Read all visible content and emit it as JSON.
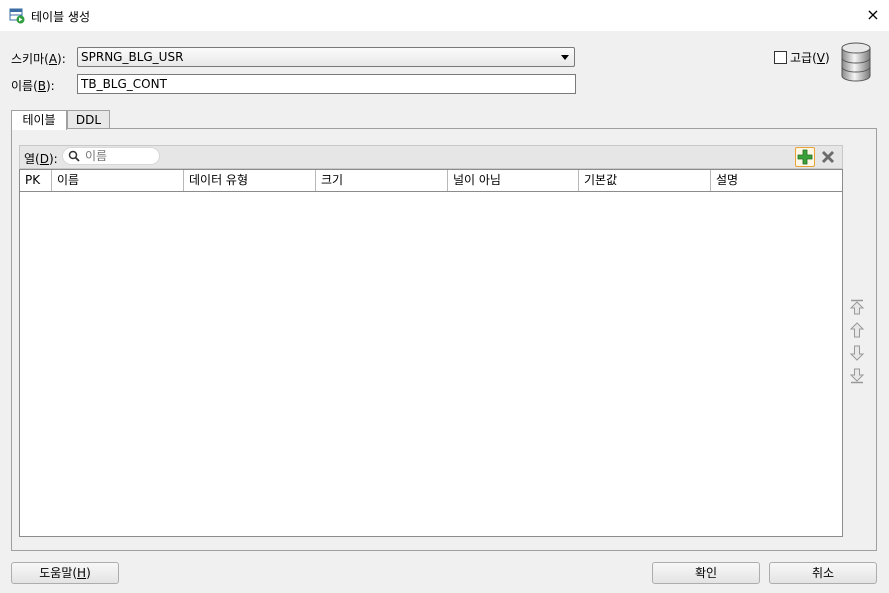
{
  "window": {
    "title": "테이블 생성",
    "close_label": "×"
  },
  "form": {
    "schema_label": "스키마(A):",
    "schema_value": "SPRNG_BLG_USR",
    "name_label": "이름(B):",
    "name_value": "TB_BLG_CONT",
    "advanced_label": "고급(V)",
    "advanced_checked": false
  },
  "tabs": [
    {
      "label": "테이블",
      "active": true
    },
    {
      "label": "DDL",
      "active": false
    }
  ],
  "columns_toolbar": {
    "label": "열(D):",
    "search_placeholder": "이름"
  },
  "table": {
    "headers": [
      "PK",
      "이름",
      "데이터 유형",
      "크기",
      "널이 아님",
      "기본값",
      "설명"
    ],
    "rows": []
  },
  "footer": {
    "help_label": "도움말(H)",
    "ok_label": "확인",
    "cancel_label": "취소"
  },
  "icons": {
    "add": "plus-icon",
    "delete": "x-icon",
    "move_top": "move-top-icon",
    "move_up": "move-up-icon",
    "move_down": "move-down-icon",
    "move_bottom": "move-bottom-icon",
    "database": "database-icon"
  },
  "colors": {
    "add_green": "#3aa03a",
    "add_border": "#e8a23a",
    "delete_gray": "#6b6b6b"
  }
}
